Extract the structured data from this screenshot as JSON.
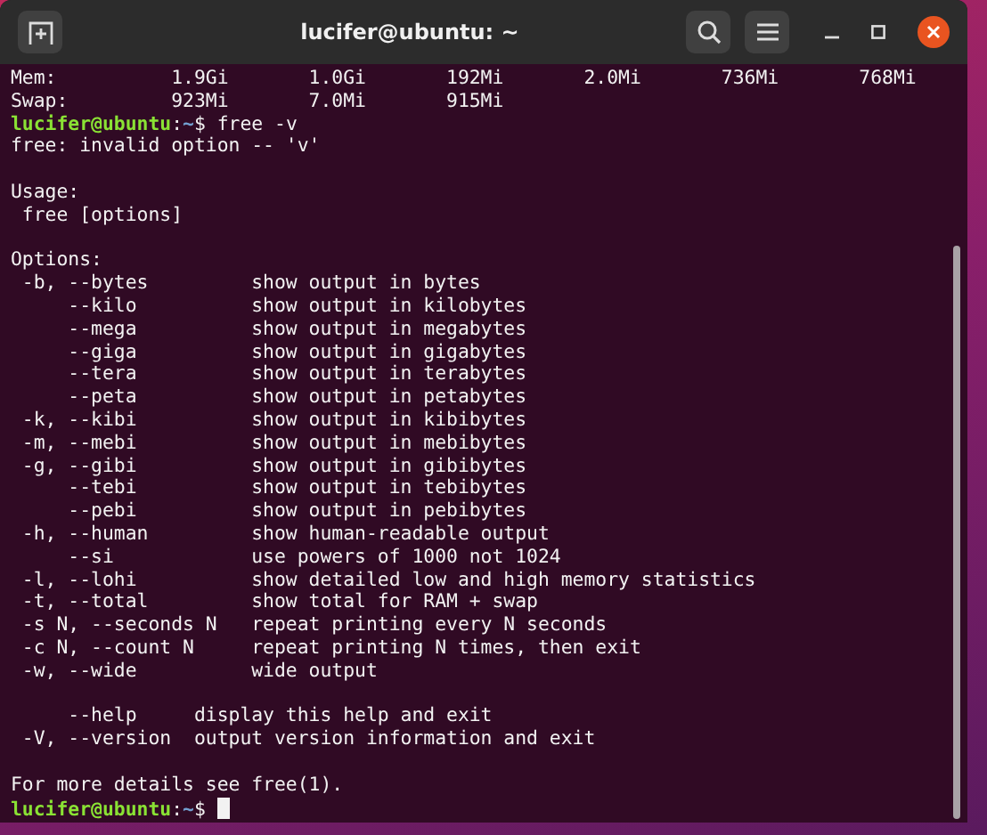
{
  "window": {
    "title": "lucifer@ubuntu: ~"
  },
  "terminal": {
    "lines": [
      {
        "kind": "output",
        "text": "Mem:          1.9Gi       1.0Gi       192Mi       2.0Mi       736Mi       768Mi"
      },
      {
        "kind": "output",
        "text": "Swap:         923Mi       7.0Mi       915Mi"
      },
      {
        "kind": "prompt",
        "user": "lucifer@ubuntu",
        "separator": ":",
        "path": "~",
        "symbol": "$",
        "command": "free -v",
        "cursor": false
      },
      {
        "kind": "output",
        "text": "free: invalid option -- 'v'"
      },
      {
        "kind": "blank"
      },
      {
        "kind": "output",
        "text": "Usage:"
      },
      {
        "kind": "output",
        "text": " free [options]"
      },
      {
        "kind": "blank"
      },
      {
        "kind": "output",
        "text": "Options:"
      },
      {
        "kind": "output",
        "text": " -b, --bytes         show output in bytes"
      },
      {
        "kind": "output",
        "text": "     --kilo          show output in kilobytes"
      },
      {
        "kind": "output",
        "text": "     --mega          show output in megabytes"
      },
      {
        "kind": "output",
        "text": "     --giga          show output in gigabytes"
      },
      {
        "kind": "output",
        "text": "     --tera          show output in terabytes"
      },
      {
        "kind": "output",
        "text": "     --peta          show output in petabytes"
      },
      {
        "kind": "output",
        "text": " -k, --kibi          show output in kibibytes"
      },
      {
        "kind": "output",
        "text": " -m, --mebi          show output in mebibytes"
      },
      {
        "kind": "output",
        "text": " -g, --gibi          show output in gibibytes"
      },
      {
        "kind": "output",
        "text": "     --tebi          show output in tebibytes"
      },
      {
        "kind": "output",
        "text": "     --pebi          show output in pebibytes"
      },
      {
        "kind": "output",
        "text": " -h, --human         show human-readable output"
      },
      {
        "kind": "output",
        "text": "     --si            use powers of 1000 not 1024"
      },
      {
        "kind": "output",
        "text": " -l, --lohi          show detailed low and high memory statistics"
      },
      {
        "kind": "output",
        "text": " -t, --total         show total for RAM + swap"
      },
      {
        "kind": "output",
        "text": " -s N, --seconds N   repeat printing every N seconds"
      },
      {
        "kind": "output",
        "text": " -c N, --count N     repeat printing N times, then exit"
      },
      {
        "kind": "output",
        "text": " -w, --wide          wide output"
      },
      {
        "kind": "blank"
      },
      {
        "kind": "output",
        "text": "     --help     display this help and exit"
      },
      {
        "kind": "output",
        "text": " -V, --version  output version information and exit"
      },
      {
        "kind": "blank"
      },
      {
        "kind": "output",
        "text": "For more details see free(1)."
      },
      {
        "kind": "prompt",
        "user": "lucifer@ubuntu",
        "separator": ":",
        "path": "~",
        "symbol": "$",
        "cursor": true
      }
    ]
  }
}
